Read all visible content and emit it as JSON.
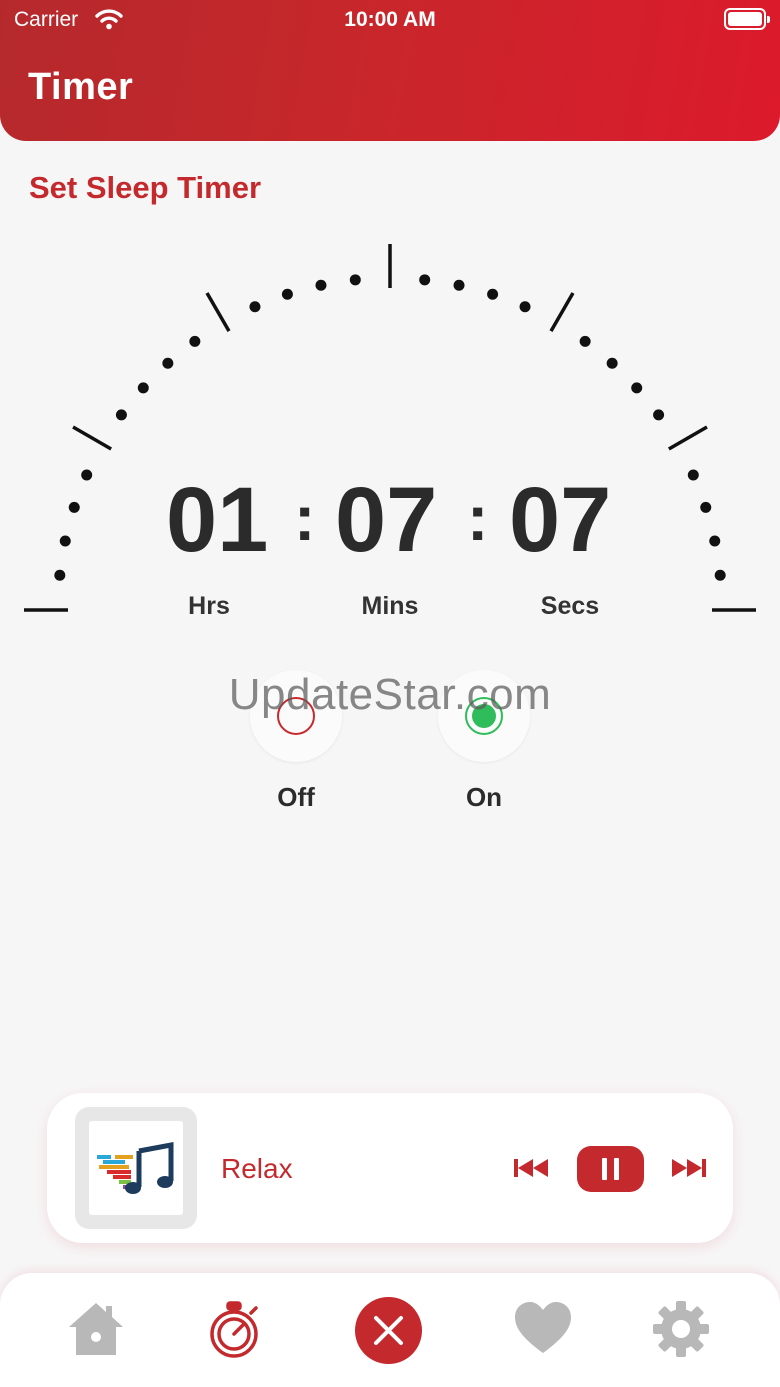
{
  "status_bar": {
    "carrier": "Carrier",
    "time": "10:00 AM"
  },
  "header": {
    "title": "Timer"
  },
  "section_title": "Set Sleep Timer",
  "timer": {
    "hours": "01",
    "minutes": "07",
    "seconds": "07",
    "separator": ":",
    "labels": {
      "hours": "Hrs",
      "minutes": "Mins",
      "seconds": "Secs"
    }
  },
  "toggle": {
    "off_label": "Off",
    "on_label": "On",
    "selected": "On"
  },
  "watermark": "UpdateStar.com",
  "player": {
    "track": "Relax",
    "state": "playing"
  },
  "tabs": [
    {
      "name": "Home",
      "icon": "home-icon",
      "active": false
    },
    {
      "name": "Timer",
      "icon": "stopwatch-icon",
      "active": true
    },
    {
      "name": "Close",
      "icon": "close-icon",
      "active": false
    },
    {
      "name": "Favorites",
      "icon": "heart-icon",
      "active": false
    },
    {
      "name": "Settings",
      "icon": "gear-icon",
      "active": false
    }
  ],
  "colors": {
    "accent": "#c42a2d",
    "header_gradient_end": "#dc1a2c",
    "on_green": "#2fbc5a",
    "inactive_icon": "#b8b8b8",
    "background": "#f7f6f7"
  }
}
